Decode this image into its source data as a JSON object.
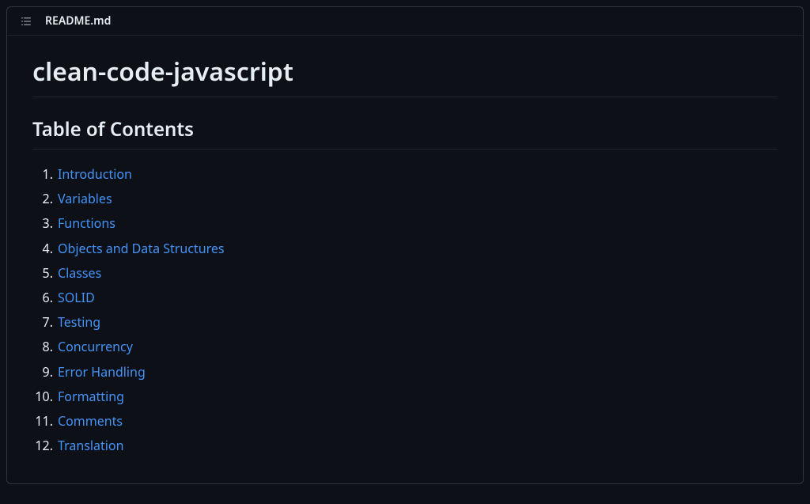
{
  "header": {
    "filename": "README.md"
  },
  "content": {
    "main_heading": "clean-code-javascript",
    "toc_heading": "Table of Contents",
    "toc_items": [
      {
        "label": "Introduction"
      },
      {
        "label": "Variables"
      },
      {
        "label": "Functions"
      },
      {
        "label": "Objects and Data Structures"
      },
      {
        "label": "Classes"
      },
      {
        "label": "SOLID"
      },
      {
        "label": "Testing"
      },
      {
        "label": "Concurrency"
      },
      {
        "label": "Error Handling"
      },
      {
        "label": "Formatting"
      },
      {
        "label": "Comments"
      },
      {
        "label": "Translation"
      }
    ]
  }
}
